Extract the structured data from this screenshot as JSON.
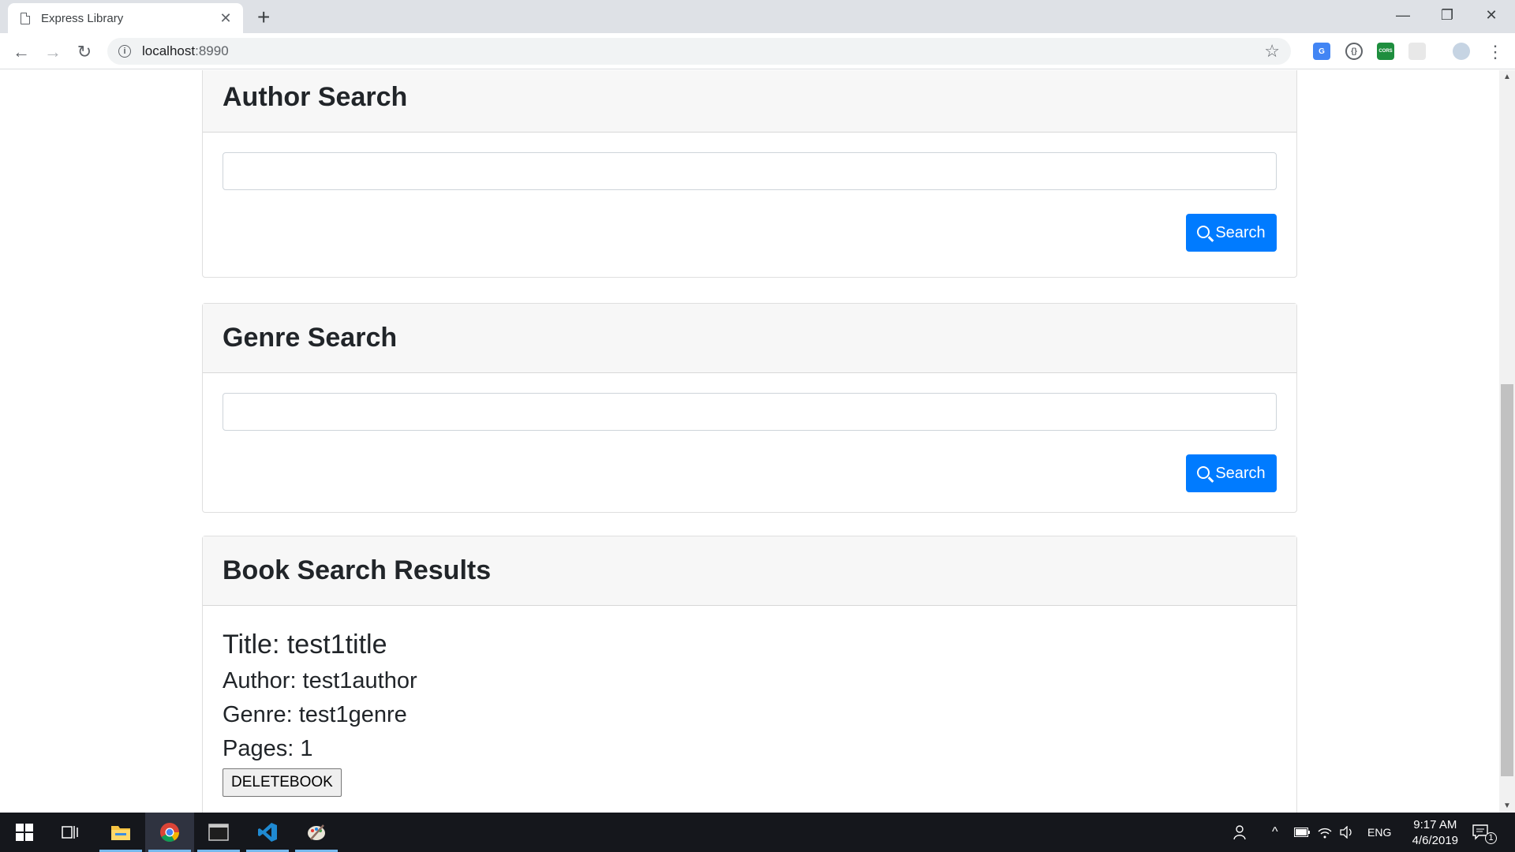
{
  "browser": {
    "tab_title": "Express Library",
    "url_host": "localhost",
    "url_port": ":8990",
    "window_controls": {
      "minimize": "—",
      "restore": "❐",
      "close": "✕"
    },
    "extensions": [
      {
        "name": "translate-icon",
        "color": "#4285f4"
      },
      {
        "name": "json-viewer-icon",
        "color": "#5f6368"
      },
      {
        "name": "cors-icon",
        "color": "#1e8e3e",
        "label": "CORS"
      },
      {
        "name": "blank-extension-icon",
        "color": "#e0e0e0"
      },
      {
        "name": "profile-avatar-icon",
        "color": "#c6d4e3"
      }
    ]
  },
  "author_search": {
    "heading": "Author Search",
    "input_value": "",
    "button_label": "Search"
  },
  "genre_search": {
    "heading": "Genre Search",
    "input_value": "",
    "button_label": "Search"
  },
  "results": {
    "heading": "Book Search Results",
    "book": {
      "title": "Title: test1title",
      "author": "Author: test1author",
      "genre": "Genre: test1genre",
      "pages": "Pages: 1"
    },
    "delete_label": "DELETEBOOK"
  },
  "taskbar": {
    "language": "ENG",
    "time": "9:17 AM",
    "date": "4/6/2019",
    "notification_count": "1"
  },
  "colors": {
    "primary": "#007bff",
    "taskbar": "#15171c"
  }
}
